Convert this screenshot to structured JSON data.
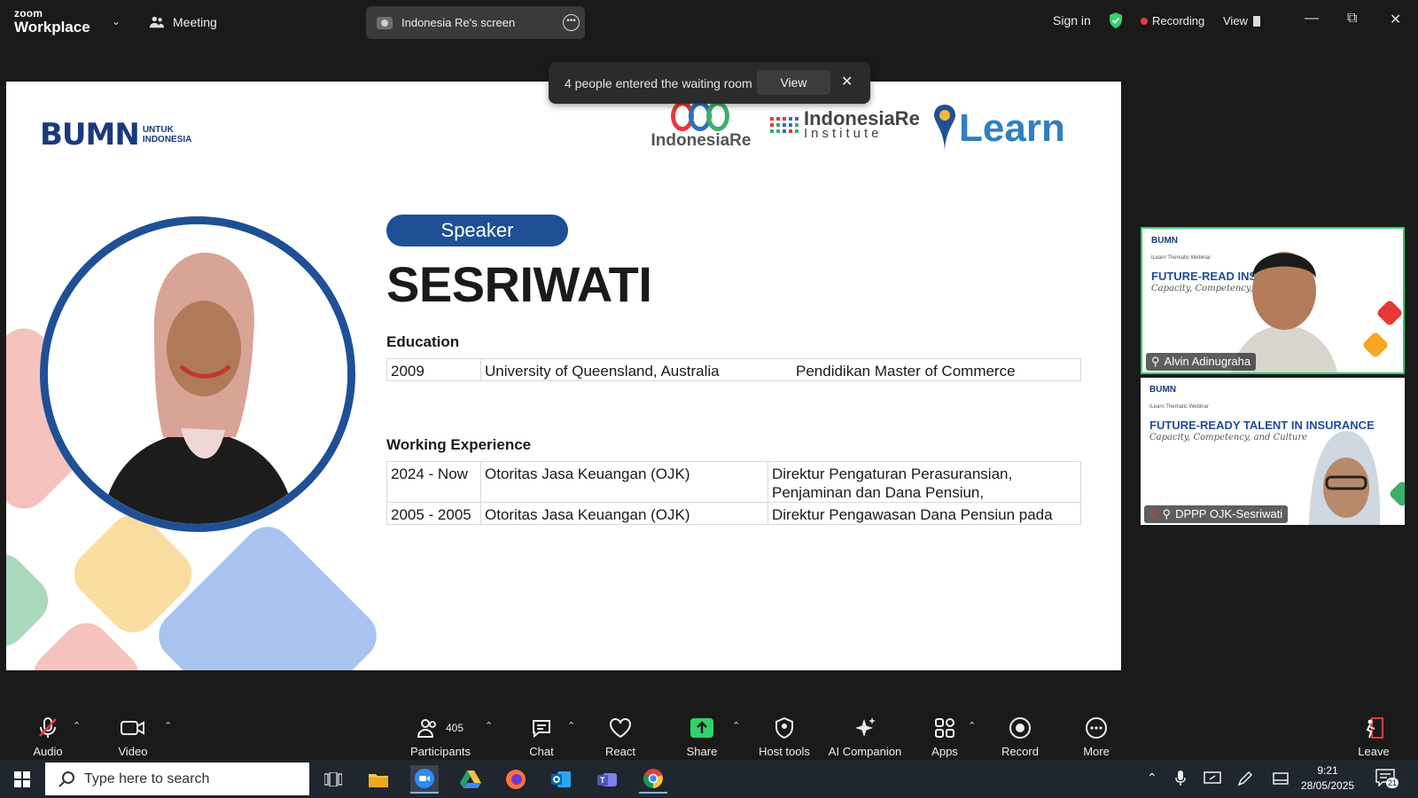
{
  "app": {
    "brand_top": "zoom",
    "brand_bottom": "Workplace",
    "meeting_label": "Meeting",
    "screen_share_label": "Indonesia Re's screen",
    "sign_in": "Sign in",
    "recording_label": "Recording",
    "view_label": "View"
  },
  "notification": {
    "message": "4 people entered the waiting room",
    "view_button": "View",
    "close": "✕"
  },
  "slide": {
    "bumn_logo": "BUMN",
    "bumn_tagline_1": "UNTUK",
    "bumn_tagline_2": "INDONESIA",
    "ire_logo": "IndonesiaRe",
    "iri_logo_1": "IndonesiaRe",
    "iri_logo_2": "Institute",
    "learn_logo": "Learn",
    "speaker_label": "Speaker",
    "speaker_name": "SESRIWATI",
    "education_title": "Education",
    "education": [
      {
        "year": "2009",
        "institution": "University of Queensland, Australia",
        "degree": "Pendidikan Master of Commerce"
      }
    ],
    "experience_title": "Working Experience",
    "experience": [
      {
        "period": "2024 - Now",
        "org": "Otoritas Jasa Keuangan (OJK)",
        "role_1": "Direktur Pengaturan Perasuransian,",
        "role_2": "Penjaminan dan Dana Pensiun,"
      },
      {
        "period": "2005 - 2005",
        "org": "Otoritas Jasa Keuangan (OJK)",
        "role_1": "Direktur Pengawasan Dana Pensiun pada",
        "role_2": ""
      }
    ]
  },
  "gallery": [
    {
      "name": "Alvin Adinugraha",
      "title": "FUTURE-READ         INSURANCE",
      "script": "Capacity, Competency, and C",
      "logo": "BUMN",
      "sub": "iLearn Thematic Webinar"
    },
    {
      "name": "DPPP OJK-Sesriwati",
      "title": "FUTURE-READY TALENT IN INSURANCE",
      "script": "Capacity, Competency, and Culture",
      "logo": "BUMN",
      "sub": "iLearn Thematic Webinar"
    }
  ],
  "toolbar": {
    "audio": "Audio",
    "video": "Video",
    "participants": "Participants",
    "participants_count": "405",
    "chat": "Chat",
    "react": "React",
    "share": "Share",
    "host_tools": "Host tools",
    "ai_companion": "AI Companion",
    "apps": "Apps",
    "record": "Record",
    "more": "More",
    "leave": "Leave"
  },
  "taskbar": {
    "search_placeholder": "Type here to search",
    "time": "9:21",
    "date": "28/05/2025",
    "notifications": "21"
  },
  "colors": {
    "zoom_green": "#2ed46b",
    "recording_red": "#e5393a",
    "slide_blue": "#1f5096"
  }
}
